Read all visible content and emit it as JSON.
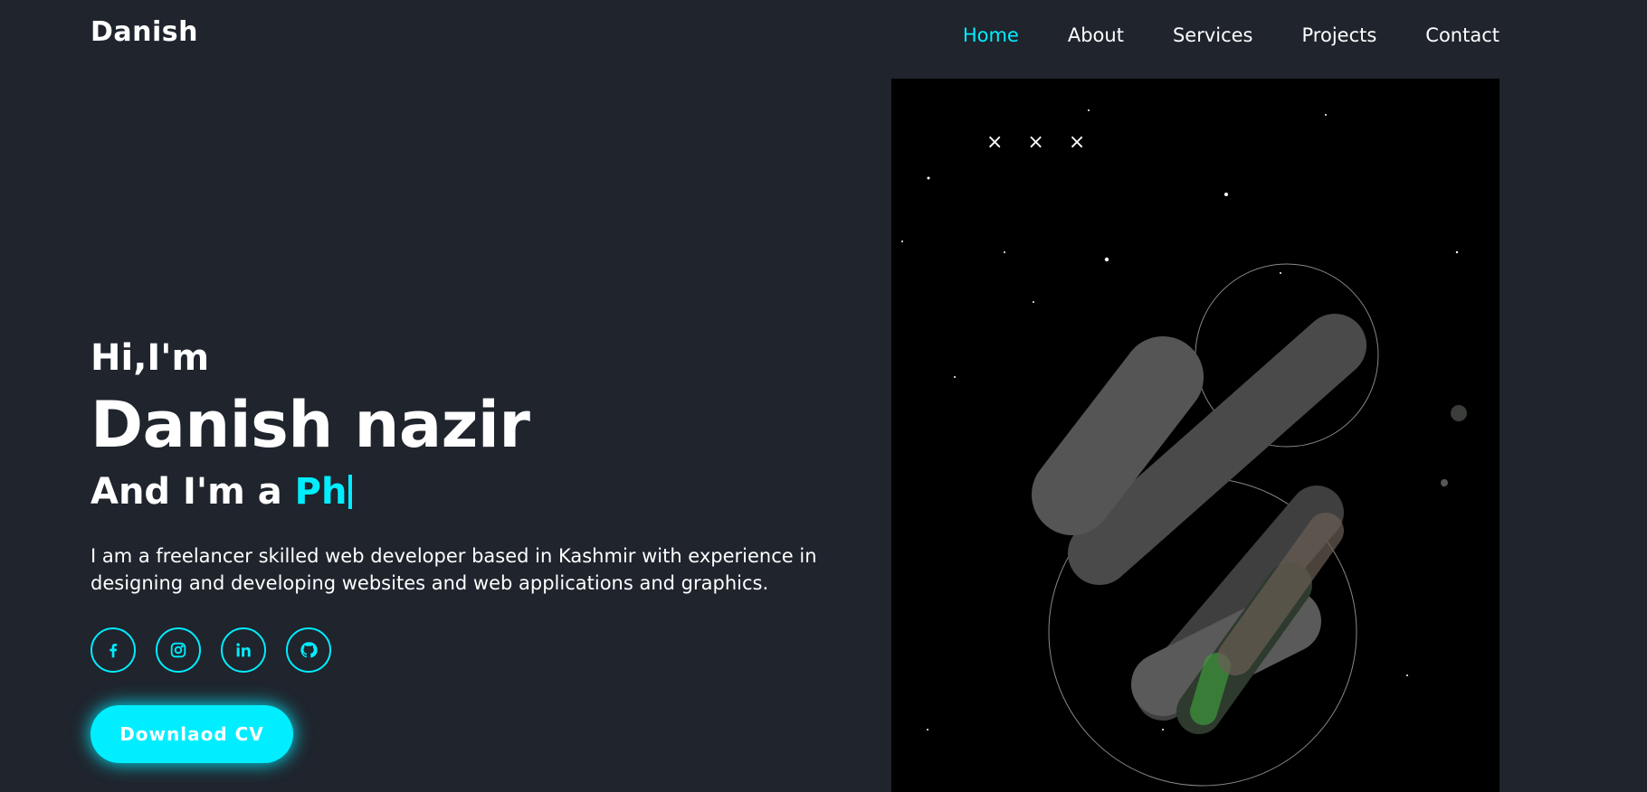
{
  "header": {
    "logo": "Danish",
    "nav": [
      {
        "label": "Home",
        "active": true
      },
      {
        "label": "About",
        "active": false
      },
      {
        "label": "Services",
        "active": false
      },
      {
        "label": "Projects",
        "active": false
      },
      {
        "label": "Contact",
        "active": false
      }
    ]
  },
  "hero": {
    "greeting": "Hi,I'm",
    "name": "Danish nazir",
    "role_prefix": "And I'm a ",
    "role_typed": "Ph",
    "bio": "I am a freelancer skilled web developer based in Kashmir with experience in designing and developing websites and web applications and graphics.",
    "socials": [
      {
        "icon": "facebook-icon"
      },
      {
        "icon": "instagram-icon"
      },
      {
        "icon": "linkedin-icon"
      },
      {
        "icon": "github-icon"
      }
    ],
    "cv_button": "Downlaod CV",
    "image_marks": "× × ×"
  },
  "colors": {
    "background": "#1f242d",
    "accent": "#00eeff",
    "text": "#ffffff"
  }
}
